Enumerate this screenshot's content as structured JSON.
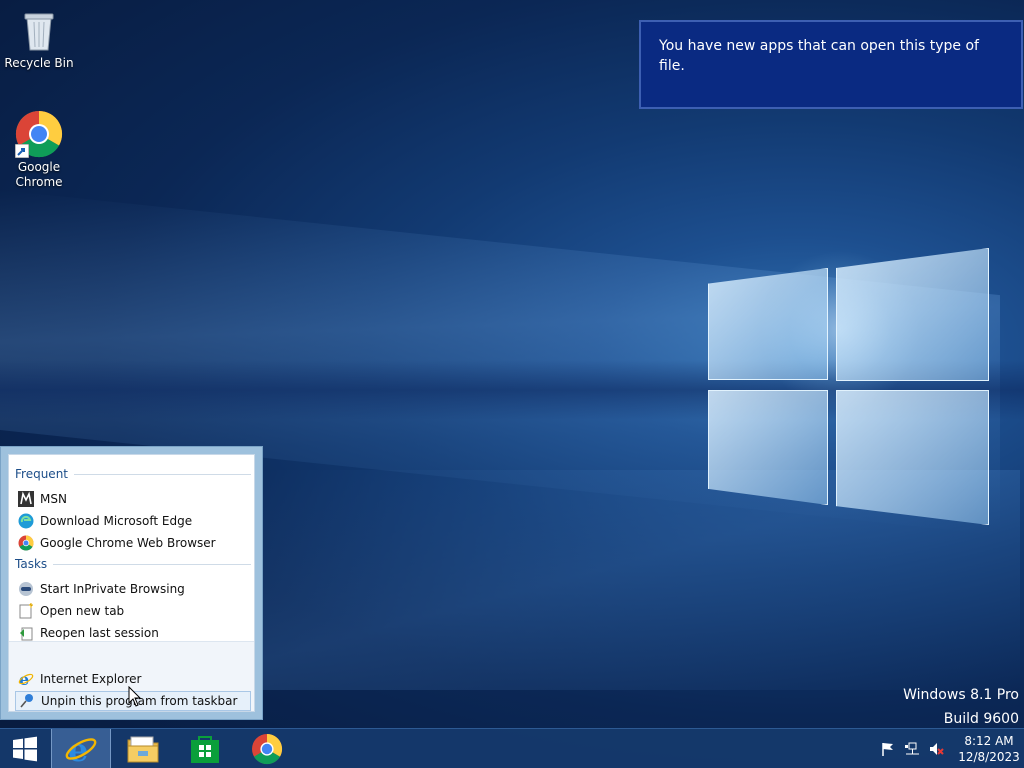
{
  "desktop": {
    "icons": [
      {
        "label": "Recycle Bin"
      },
      {
        "label": "Google Chrome"
      }
    ],
    "watermark": {
      "line1": "Windows 8.1 Pro",
      "line2": "Build 9600"
    }
  },
  "notification": {
    "text": "You have new apps that can open this type of file."
  },
  "jumplist": {
    "frequent_header": "Frequent",
    "frequent": [
      {
        "label": "MSN",
        "icon": "msn-icon"
      },
      {
        "label": "Download Microsoft Edge",
        "icon": "edge-icon"
      },
      {
        "label": "Google Chrome Web Browser",
        "icon": "chrome-icon"
      }
    ],
    "tasks_header": "Tasks",
    "tasks": [
      {
        "label": "Start InPrivate Browsing",
        "icon": "inprivate-icon"
      },
      {
        "label": "Open new tab",
        "icon": "new-tab-icon"
      },
      {
        "label": "Reopen last session",
        "icon": "reopen-icon"
      }
    ],
    "program": {
      "label": "Internet Explorer",
      "icon": "ie-icon"
    },
    "unpin": {
      "label": "Unpin this program from taskbar",
      "icon": "unpin-icon"
    }
  },
  "taskbar": {
    "buttons": [
      {
        "name": "start",
        "icon": "windows-logo-icon"
      },
      {
        "name": "internet-explorer",
        "icon": "ie-icon",
        "active": true
      },
      {
        "name": "file-explorer",
        "icon": "folder-icon"
      },
      {
        "name": "store",
        "icon": "store-icon"
      },
      {
        "name": "chrome",
        "icon": "chrome-icon"
      }
    ],
    "tray": {
      "icons": [
        "flag-icon",
        "network-icon",
        "volume-muted-icon"
      ],
      "time": "8:12 AM",
      "date": "12/8/2023"
    }
  },
  "colors": {
    "notification_bg": "#0a2a82",
    "jumplist_frame": "#9ec1dd",
    "taskbar": "#163a6c",
    "header_text": "#1d4e89"
  }
}
